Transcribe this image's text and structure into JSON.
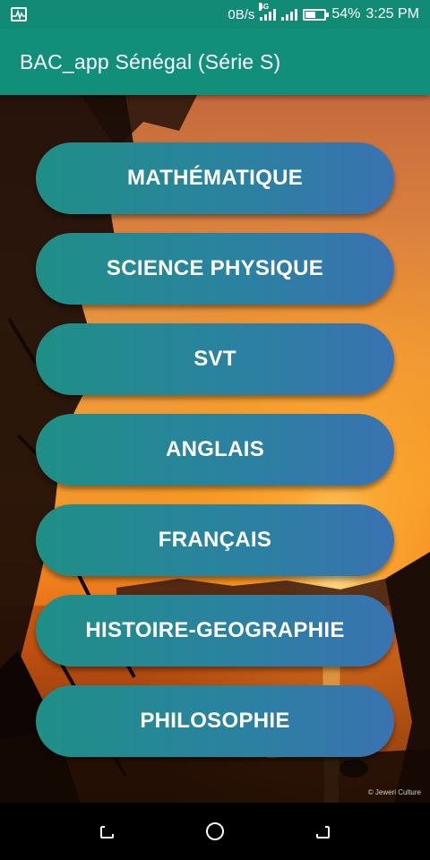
{
  "status_bar": {
    "net_speed": "0B/s",
    "network_type": "4G",
    "battery_percent": "54%",
    "time": "3:25 PM",
    "icons": [
      "activity-monitor-icon",
      "signal-icon",
      "battery-icon"
    ]
  },
  "app_bar": {
    "title": "BAC_app Sénégal (Série S)"
  },
  "subjects": [
    "MATHÉMATIQUE",
    "SCIENCE PHYSIQUE",
    "SVT",
    "ANGLAIS",
    "FRANÇAIS",
    "HISTOIRE-GEOGRAPHIE",
    "PHILOSOPHIE"
  ],
  "watermark": "© Jeweri Culture",
  "nav_bar": {
    "icons": [
      "recent-apps-icon",
      "home-icon",
      "back-icon"
    ]
  },
  "colors": {
    "primary": "#128f7b",
    "status_bar": "#118a76",
    "button_start": "#1f8f86",
    "button_end": "#3a72b2"
  }
}
